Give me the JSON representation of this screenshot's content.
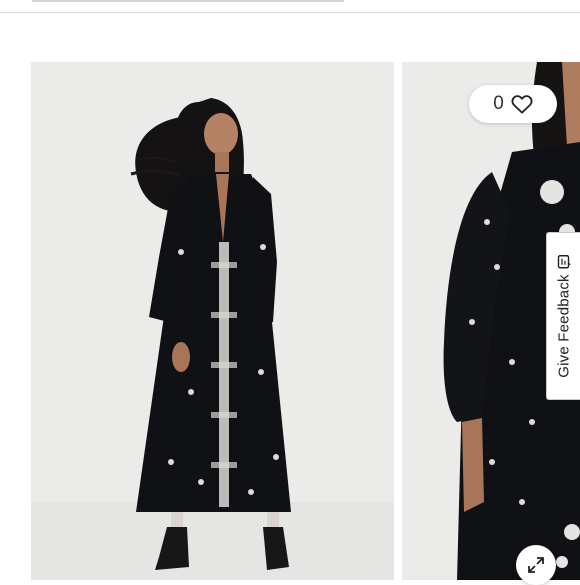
{
  "product_gallery": {
    "images": [
      {
        "icon": "photo-model-full-length"
      },
      {
        "icon": "photo-model-closeup"
      }
    ]
  },
  "wishlist": {
    "count": "0",
    "icon": "heart-icon"
  },
  "feedback": {
    "label": "Give Feedback",
    "icon": "feedback-icon"
  },
  "expand": {
    "icon": "expand-icon"
  },
  "colors": {
    "dress": "#101114",
    "background": "#ececea",
    "accent_border": "#c9c9c9"
  }
}
